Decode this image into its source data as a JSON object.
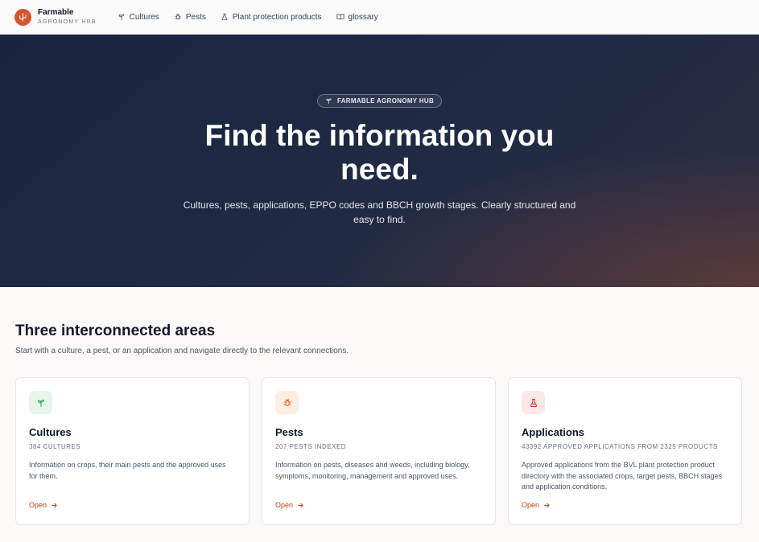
{
  "brand": {
    "name": "Farmable",
    "subtitle": "AGRONOMY HUB"
  },
  "nav": {
    "links": [
      {
        "label": "Cultures",
        "icon": "sprout-icon"
      },
      {
        "label": "Pests",
        "icon": "bug-icon"
      },
      {
        "label": "Plant protection products",
        "icon": "flask-icon"
      },
      {
        "label": "glossary",
        "icon": "book-icon"
      }
    ]
  },
  "hero": {
    "badge": "FARMABLE AGRONOMY HUB",
    "title": "Find the information you need.",
    "subtitle": "Cultures, pests, applications, EPPO codes and BBCH growth stages. Clearly structured and easy to find."
  },
  "section": {
    "title": "Three interconnected areas",
    "subtitle": "Start with a culture, a pest, or an application and navigate directly to the relevant connections."
  },
  "cards": [
    {
      "title": "Cultures",
      "count": "384 CULTURES",
      "description": "Information on crops, their main pests and the approved uses for them.",
      "link": "Open",
      "icon": "sprout-icon",
      "icon_color": "#16a34a",
      "icon_bg": "#e8f5ea"
    },
    {
      "title": "Pests",
      "count": "207 PESTS INDEXED",
      "description": "Information on pests, diseases and weeds, including biology, symptoms, monitoring, management and approved uses.",
      "link": "Open",
      "icon": "bug-icon",
      "icon_color": "#ea580c",
      "icon_bg": "#fdeee3"
    },
    {
      "title": "Applications",
      "count": "43392 APPROVED APPLICATIONS FROM 2325 PRODUCTS",
      "description": "Approved applications from the BVL plant protection product directory with the associated crops, target pests, BBCH stages and application conditions.",
      "link": "Open",
      "icon": "flask-icon",
      "icon_color": "#dc2626",
      "icon_bg": "#fde8e8"
    }
  ],
  "colors": {
    "accent": "#c2410c",
    "logo": "#d9532b"
  }
}
